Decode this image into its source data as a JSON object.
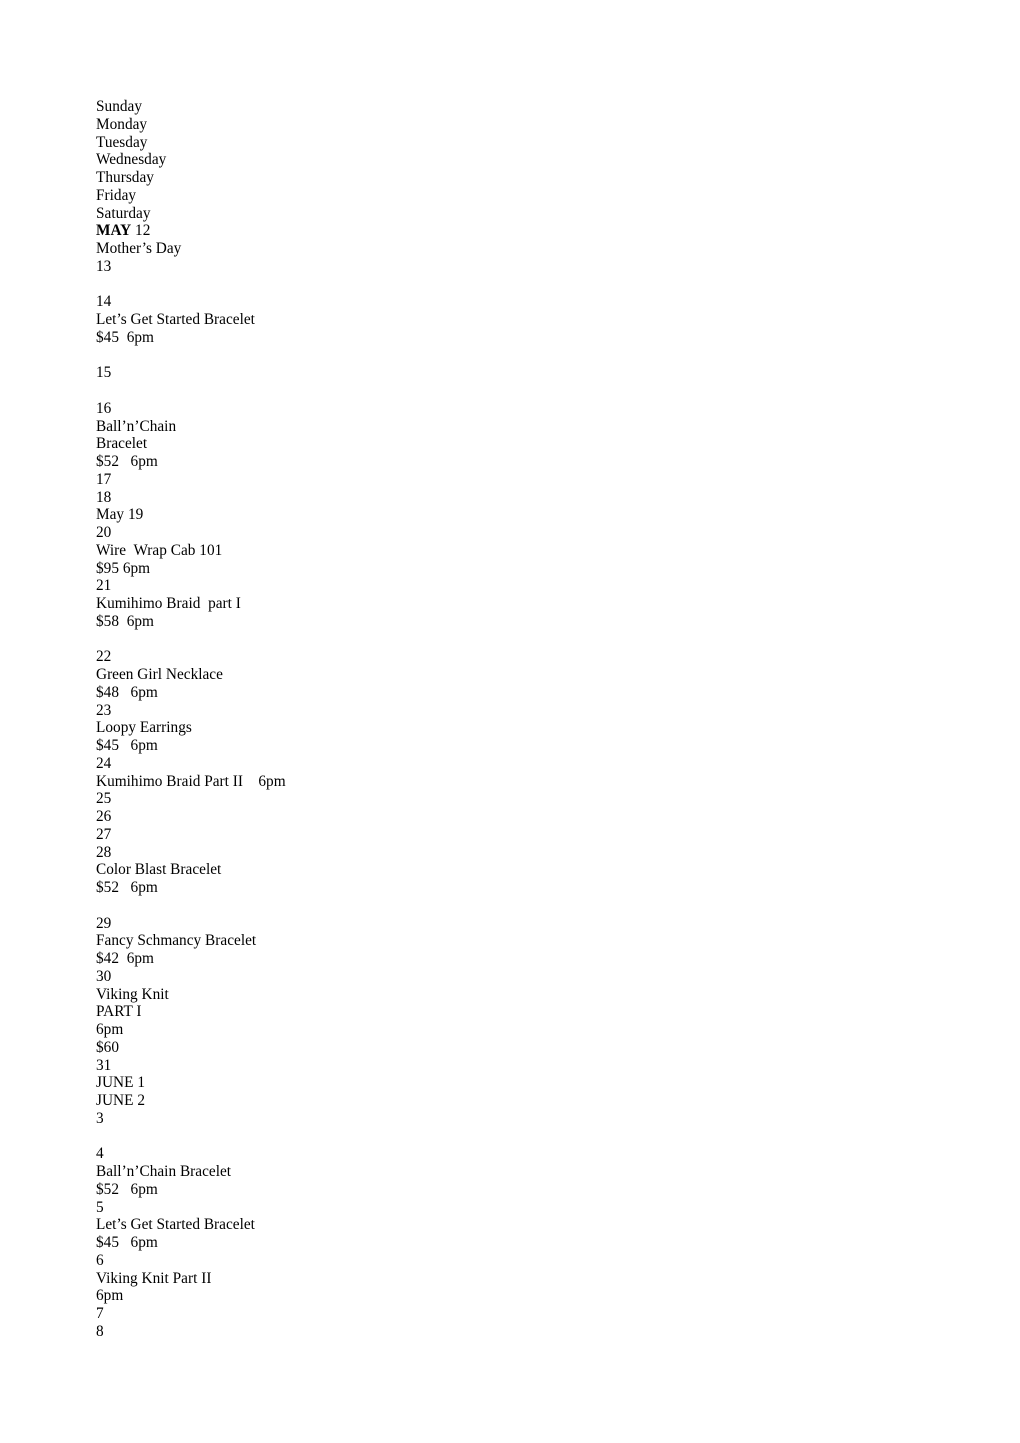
{
  "document": {
    "title": "Jewelry Class Calendar — May / June",
    "background_color": "#ffffff",
    "text_color": "#000000",
    "weekday_headers": [
      "Sunday",
      "Monday",
      "Tuesday",
      "Wednesday",
      "Thursday",
      "Friday",
      "Saturday"
    ],
    "lines": [
      {
        "kind": "text",
        "text": "Sunday"
      },
      {
        "kind": "text",
        "text": "Monday"
      },
      {
        "kind": "text",
        "text": "Tuesday"
      },
      {
        "kind": "text",
        "text": "Wednesday"
      },
      {
        "kind": "text",
        "text": "Thursday"
      },
      {
        "kind": "text",
        "text": "Friday"
      },
      {
        "kind": "text",
        "text": "Saturday"
      },
      {
        "kind": "rich",
        "bold_prefix": "MAY",
        "text": " 12"
      },
      {
        "kind": "text",
        "text": "Mother’s Day"
      },
      {
        "kind": "text",
        "text": "13"
      },
      {
        "kind": "blank",
        "text": ""
      },
      {
        "kind": "text",
        "text": "14"
      },
      {
        "kind": "text",
        "text": "Let’s Get Started Bracelet"
      },
      {
        "kind": "text",
        "text": "$45  6pm"
      },
      {
        "kind": "blank",
        "text": ""
      },
      {
        "kind": "text",
        "text": "15"
      },
      {
        "kind": "blank",
        "text": ""
      },
      {
        "kind": "text",
        "text": "16"
      },
      {
        "kind": "text",
        "text": "Ball’n’Chain"
      },
      {
        "kind": "text",
        "text": "Bracelet"
      },
      {
        "kind": "text",
        "text": "$52   6pm"
      },
      {
        "kind": "text",
        "text": "17"
      },
      {
        "kind": "text",
        "text": "18"
      },
      {
        "kind": "text",
        "text": "May 19"
      },
      {
        "kind": "text",
        "text": "20"
      },
      {
        "kind": "text",
        "text": "Wire  Wrap Cab 101"
      },
      {
        "kind": "text",
        "text": "$95 6pm"
      },
      {
        "kind": "text",
        "text": "21"
      },
      {
        "kind": "text",
        "text": "Kumihimo Braid  part I"
      },
      {
        "kind": "text",
        "text": "$58  6pm"
      },
      {
        "kind": "blank",
        "text": ""
      },
      {
        "kind": "text",
        "text": "22"
      },
      {
        "kind": "text",
        "text": "Green Girl Necklace"
      },
      {
        "kind": "text",
        "text": "$48   6pm"
      },
      {
        "kind": "text",
        "text": "23"
      },
      {
        "kind": "text",
        "text": "Loopy Earrings"
      },
      {
        "kind": "text",
        "text": "$45   6pm"
      },
      {
        "kind": "text",
        "text": "24"
      },
      {
        "kind": "text",
        "text": "Kumihimo Braid Part II    6pm"
      },
      {
        "kind": "text",
        "text": "25"
      },
      {
        "kind": "text",
        "text": "26"
      },
      {
        "kind": "text",
        "text": "27"
      },
      {
        "kind": "text",
        "text": "28"
      },
      {
        "kind": "text",
        "text": "Color Blast Bracelet"
      },
      {
        "kind": "text",
        "text": "$52   6pm"
      },
      {
        "kind": "blank",
        "text": ""
      },
      {
        "kind": "text",
        "text": "29"
      },
      {
        "kind": "text",
        "text": "Fancy Schmancy Bracelet"
      },
      {
        "kind": "text",
        "text": "$42  6pm"
      },
      {
        "kind": "text",
        "text": "30"
      },
      {
        "kind": "text",
        "text": "Viking Knit"
      },
      {
        "kind": "text",
        "text": "PART I"
      },
      {
        "kind": "text",
        "text": "6pm"
      },
      {
        "kind": "text",
        "text": "$60"
      },
      {
        "kind": "text",
        "text": "31"
      },
      {
        "kind": "text",
        "text": "JUNE 1"
      },
      {
        "kind": "text",
        "text": "JUNE 2"
      },
      {
        "kind": "text",
        "text": "3"
      },
      {
        "kind": "blank",
        "text": ""
      },
      {
        "kind": "text",
        "text": "4"
      },
      {
        "kind": "text",
        "text": "Ball’n’Chain Bracelet"
      },
      {
        "kind": "text",
        "text": "$52   6pm"
      },
      {
        "kind": "text",
        "text": "5"
      },
      {
        "kind": "text",
        "text": "Let’s Get Started Bracelet"
      },
      {
        "kind": "text",
        "text": "$45   6pm"
      },
      {
        "kind": "text",
        "text": "6"
      },
      {
        "kind": "text",
        "text": "Viking Knit Part II"
      },
      {
        "kind": "text",
        "text": "6pm"
      },
      {
        "kind": "text",
        "text": "7"
      },
      {
        "kind": "text",
        "text": "8"
      }
    ],
    "classes": [
      {
        "date": "14",
        "name": "Let’s Get Started Bracelet",
        "price": "$45",
        "time": "6pm"
      },
      {
        "date": "16",
        "name": "Ball’n’Chain Bracelet",
        "price": "$52",
        "time": "6pm"
      },
      {
        "date": "20",
        "name": "Wire  Wrap Cab 101",
        "price": "$95",
        "time": "6pm"
      },
      {
        "date": "21",
        "name": "Kumihimo Braid  part I",
        "price": "$58",
        "time": "6pm"
      },
      {
        "date": "22",
        "name": "Green Girl Necklace",
        "price": "$48",
        "time": "6pm"
      },
      {
        "date": "23",
        "name": "Loopy Earrings",
        "price": "$45",
        "time": "6pm"
      },
      {
        "date": "24",
        "name": "Kumihimo Braid Part II",
        "price": "",
        "time": "6pm"
      },
      {
        "date": "28",
        "name": "Color Blast Bracelet",
        "price": "$52",
        "time": "6pm"
      },
      {
        "date": "29",
        "name": "Fancy Schmancy Bracelet",
        "price": "$42",
        "time": "6pm"
      },
      {
        "date": "30",
        "name": "Viking Knit PART I",
        "price": "$60",
        "time": "6pm"
      },
      {
        "date": "4",
        "name": "Ball’n’Chain Bracelet",
        "price": "$52",
        "time": "6pm"
      },
      {
        "date": "5",
        "name": "Let’s Get Started Bracelet",
        "price": "$45",
        "time": "6pm"
      },
      {
        "date": "6",
        "name": "Viking Knit Part II",
        "price": "",
        "time": "6pm"
      }
    ],
    "holidays": [
      {
        "date": "12",
        "name": "Mother’s Day"
      }
    ],
    "month_markers": [
      "MAY 12",
      "May 19",
      "JUNE 1",
      "JUNE 2"
    ]
  }
}
